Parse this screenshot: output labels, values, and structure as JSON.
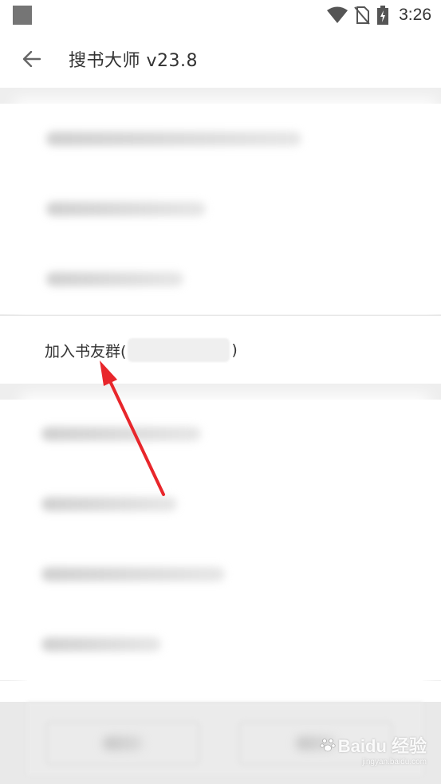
{
  "status_bar": {
    "time": "3:26"
  },
  "app_bar": {
    "title": "搜书大师 v23.8"
  },
  "join_group": {
    "label_prefix": "加入书友群(",
    "label_suffix": ")"
  },
  "watermark": {
    "main": "Baidu 经验",
    "sub": "jingyan.baidu.com"
  },
  "colors": {
    "arrow": "#e8262b",
    "section_gap": "#eeeeee",
    "text": "#333333"
  }
}
